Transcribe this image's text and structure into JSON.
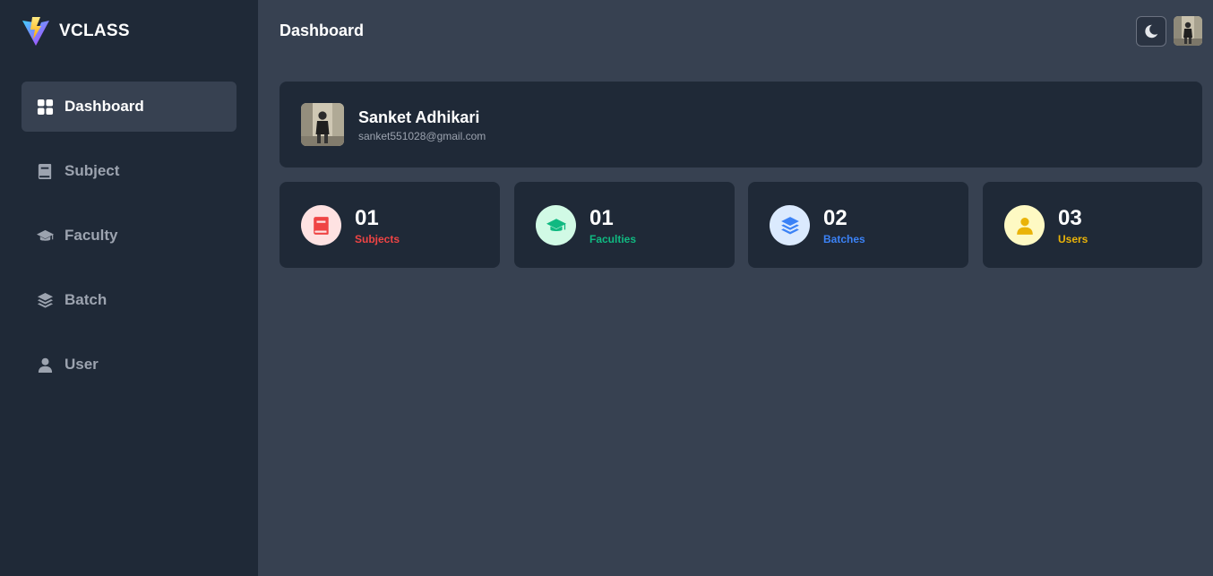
{
  "brand": {
    "name": "VCLASS"
  },
  "sidebar": {
    "items": [
      {
        "label": "Dashboard",
        "icon": "dashboard-grid-icon",
        "active": true
      },
      {
        "label": "Subject",
        "icon": "book-icon",
        "active": false
      },
      {
        "label": "Faculty",
        "icon": "graduation-cap-icon",
        "active": false
      },
      {
        "label": "Batch",
        "icon": "layers-icon",
        "active": false
      },
      {
        "label": "User",
        "icon": "user-icon",
        "active": false
      }
    ]
  },
  "header": {
    "title": "Dashboard",
    "theme_icon": "moon-icon"
  },
  "profile": {
    "name": "Sanket Adhikari",
    "email": "sanket551028@gmail.com"
  },
  "stats": [
    {
      "value": "01",
      "label": "Subjects",
      "icon": "book-icon",
      "color": "#ef4444",
      "bg": "#fee2e2"
    },
    {
      "value": "01",
      "label": "Faculties",
      "icon": "graduation-cap-icon",
      "color": "#10b981",
      "bg": "#d1fae5"
    },
    {
      "value": "02",
      "label": "Batches",
      "icon": "layers-icon",
      "color": "#3b82f6",
      "bg": "#dbeafe"
    },
    {
      "value": "03",
      "label": "Users",
      "icon": "user-icon",
      "color": "#eab308",
      "bg": "#fef9c3"
    }
  ],
  "colors": {
    "sidebar_bg": "#1f2937",
    "main_bg": "#374151",
    "card_bg": "#1f2937"
  }
}
